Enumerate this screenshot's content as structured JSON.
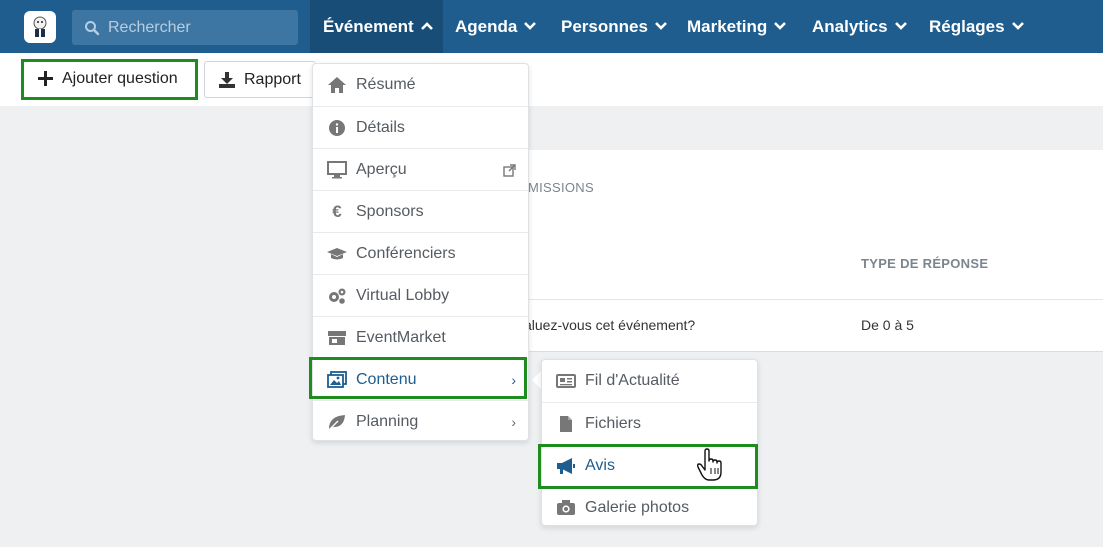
{
  "search": {
    "placeholder": "Rechercher"
  },
  "nav": [
    {
      "label": "Événement"
    },
    {
      "label": "Agenda"
    },
    {
      "label": "Personnes"
    },
    {
      "label": "Marketing"
    },
    {
      "label": "Analytics"
    },
    {
      "label": "Réglages"
    }
  ],
  "toolbar": {
    "add_question": "Ajouter question",
    "report": "Rapport"
  },
  "card": {
    "section_label": "MISSIONS",
    "col_response_type": "TYPE DE RÉPONSE",
    "row_question": "aluez-vous cet événement?",
    "row_response": "De 0 à 5"
  },
  "event_menu": [
    {
      "label": "Résumé",
      "icon": "home-icon"
    },
    {
      "label": "Détails",
      "icon": "info-icon"
    },
    {
      "label": "Aperçu",
      "icon": "monitor-icon"
    },
    {
      "label": "Sponsors",
      "icon": "euro-icon"
    },
    {
      "label": "Conférenciers",
      "icon": "graduation-cap-icon"
    },
    {
      "label": "Virtual Lobby",
      "icon": "gears-icon"
    },
    {
      "label": "EventMarket",
      "icon": "store-icon"
    },
    {
      "label": "Contenu",
      "icon": "images-icon"
    },
    {
      "label": "Planning",
      "icon": "leaf-icon"
    }
  ],
  "content_menu": [
    {
      "label": "Fil d'Actualité",
      "icon": "newspaper-icon"
    },
    {
      "label": "Fichiers",
      "icon": "file-icon"
    },
    {
      "label": "Avis",
      "icon": "megaphone-icon"
    },
    {
      "label": "Galerie photos",
      "icon": "camera-icon"
    }
  ],
  "colors": {
    "nav_bg": "#1e5d8e",
    "nav_active": "#184d77",
    "highlight": "#1f8c1f",
    "selected_text": "#1e5d8e"
  }
}
